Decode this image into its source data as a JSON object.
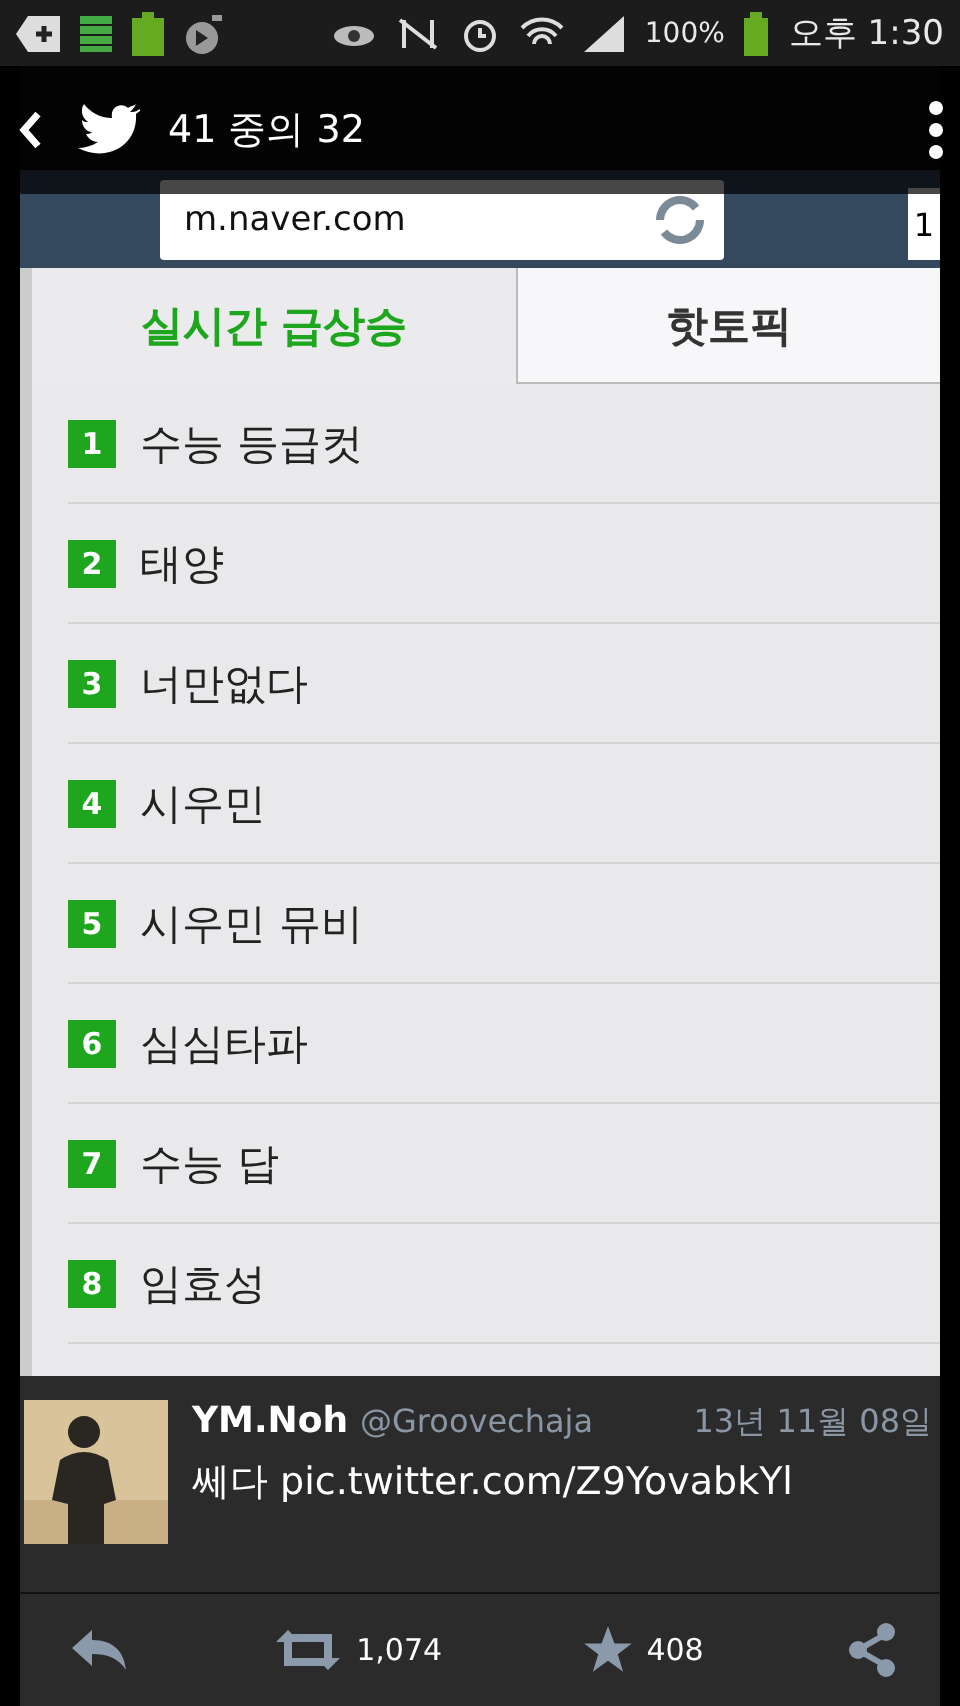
{
  "status_bar": {
    "battery": "100%",
    "time": "오후 1:30"
  },
  "viewer": {
    "counter": "41 중의 32"
  },
  "browser": {
    "url": "m.naver.com",
    "tab_count": "1"
  },
  "tabs": [
    {
      "label": "실시간 급상승",
      "selected": true
    },
    {
      "label": "핫토픽",
      "selected": false
    }
  ],
  "ranking": [
    {
      "rank": "1",
      "term": "수능 등급컷"
    },
    {
      "rank": "2",
      "term": "태양"
    },
    {
      "rank": "3",
      "term": "너만없다"
    },
    {
      "rank": "4",
      "term": "시우민"
    },
    {
      "rank": "5",
      "term": "시우민 뮤비"
    },
    {
      "rank": "6",
      "term": "심심타파"
    },
    {
      "rank": "7",
      "term": "수능 답"
    },
    {
      "rank": "8",
      "term": "임효성"
    }
  ],
  "tweet": {
    "name": "YM.Noh",
    "handle": "@Groovechaja",
    "date": "13년 11월 08일",
    "text": "쎄다 pic.twitter.com/Z9YovabkYl",
    "retweets": "1,074",
    "favorites": "408"
  }
}
